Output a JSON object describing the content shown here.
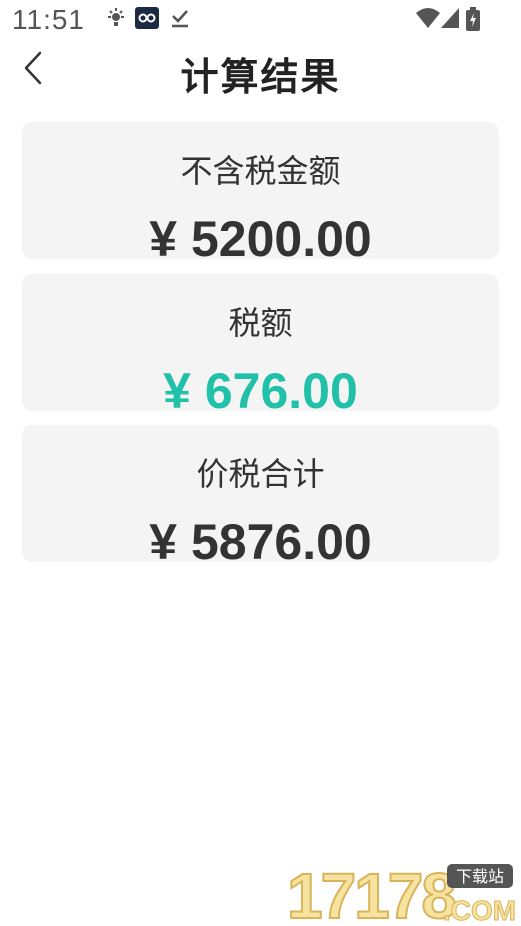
{
  "status_bar": {
    "time": "11:51",
    "icons": [
      "weather-icon",
      "app-notification-icon",
      "download-done-icon",
      "wifi-icon",
      "signal-icon",
      "battery-icon"
    ]
  },
  "header": {
    "title": "计算结果",
    "back_icon": "chevron-left-icon"
  },
  "results": [
    {
      "label": "不含税金额",
      "value": "¥ 5200.00",
      "color": "#333333"
    },
    {
      "label": "税额",
      "value": "¥ 676.00",
      "color": "#20c1a8"
    },
    {
      "label": "价税合计",
      "value": "¥ 5876.00",
      "color": "#333333"
    }
  ],
  "watermark": {
    "brand": "17178",
    "badge": "下载站",
    "suffix": ".COM"
  }
}
